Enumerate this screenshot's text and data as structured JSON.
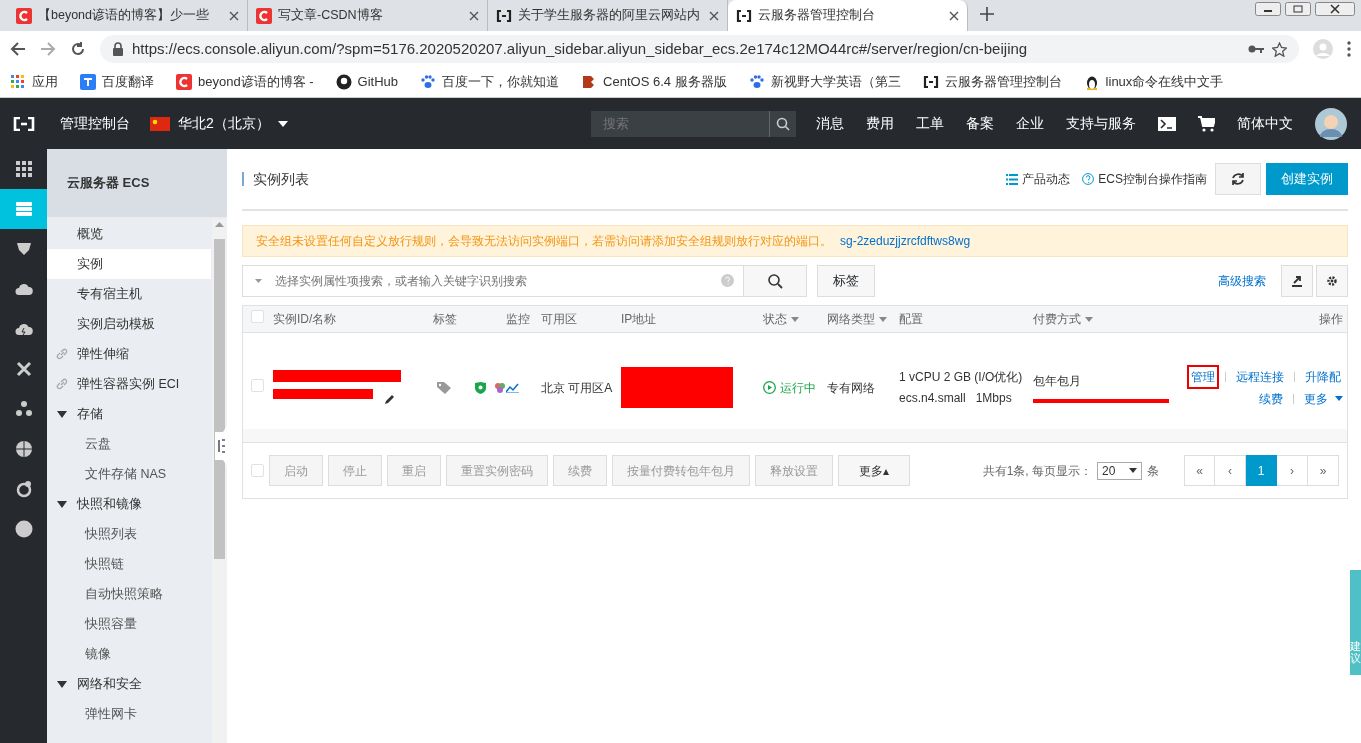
{
  "browser": {
    "tabs": [
      {
        "title": "【beyond谚语的博客】少一些",
        "selected": false
      },
      {
        "title": "写文章-CSDN博客",
        "selected": false
      },
      {
        "title": "关于学生服务器的阿里云网站内",
        "selected": false
      },
      {
        "title": "云服务器管理控制台",
        "selected": true
      }
    ],
    "url": "https://ecs.console.aliyun.com/?spm=5176.2020520207.aliyun_sidebar.aliyun_sidebar_ecs.2e174c12MO44rc#/server/region/cn-beijing",
    "bookmarks": [
      "应用",
      "百度翻译",
      "beyond谚语的博客 -",
      "GitHub",
      "百度一下，你就知道",
      "CentOS 6.4 服务器版",
      "新视野大学英语（第三",
      "云服务器管理控制台",
      "linux命令在线中文手"
    ]
  },
  "topbar": {
    "brand": "管理控制台",
    "region": "华北2（北京）",
    "search_placeholder": "搜索",
    "nav": [
      "消息",
      "费用",
      "工单",
      "备案",
      "企业",
      "支持与服务"
    ],
    "language": "简体中文"
  },
  "rail": [
    {
      "selected": false
    },
    {
      "selected": true
    },
    {
      "selected": false
    },
    {
      "selected": false
    },
    {
      "selected": false
    },
    {
      "selected": false
    },
    {
      "selected": false
    },
    {
      "selected": false
    },
    {
      "selected": false
    },
    {
      "selected": false
    }
  ],
  "sidebar": {
    "title": "云服务器 ECS",
    "items": [
      {
        "label": "概览",
        "kind": "item",
        "selected": false
      },
      {
        "label": "实例",
        "kind": "item",
        "selected": true
      },
      {
        "label": "专有宿主机",
        "kind": "item",
        "selected": false
      },
      {
        "label": "实例启动模板",
        "kind": "item",
        "selected": false
      },
      {
        "label": "弹性伸缩",
        "kind": "link",
        "selected": false
      },
      {
        "label": "弹性容器实例 ECI",
        "kind": "link",
        "selected": false
      },
      {
        "label": "存储",
        "kind": "group",
        "expanded": true,
        "children": [
          {
            "label": "云盘"
          },
          {
            "label": "文件存储 NAS"
          }
        ]
      },
      {
        "label": "快照和镜像",
        "kind": "group",
        "expanded": true,
        "children": [
          {
            "label": "快照列表"
          },
          {
            "label": "快照链"
          },
          {
            "label": "自动快照策略"
          },
          {
            "label": "快照容量"
          },
          {
            "label": "镜像"
          }
        ]
      },
      {
        "label": "网络和安全",
        "kind": "group",
        "expanded": true,
        "children": [
          {
            "label": "弹性网卡"
          }
        ]
      }
    ]
  },
  "main": {
    "title": "实例列表",
    "links": [
      "产品动态",
      "ECS控制台操作指南"
    ],
    "create_button": "创建实例",
    "alert": {
      "text": "安全组未设置任何自定义放行规则，会导致无法访问实例端口，若需访问请添加安全组规则放行对应的端口。",
      "link": "sg-2zeduzjjzrcfdftws8wg"
    },
    "search_placeholder": "选择实例属性项搜索，或者输入关键字识别搜索",
    "tag_button": "标签",
    "advanced_search": "高级搜索",
    "table": {
      "all_checked": false,
      "columns": [
        "实例ID/名称",
        "标签",
        "监控",
        "可用区",
        "IP地址",
        "状态",
        "网络类型",
        "配置",
        "付费方式",
        "操作"
      ],
      "rows": [
        {
          "checked": false,
          "zone": "北京 可用区A",
          "status": "运行中",
          "network": "专有网络",
          "config": [
            "1 vCPU 2 GB (I/O优化)",
            "ecs.n4.small   1Mbps"
          ],
          "billing": "包年包月",
          "actions": [
            {
              "label": "管理",
              "highlighted": true
            },
            {
              "label": "远程连接",
              "highlighted": false
            },
            {
              "label": "升降配",
              "highlighted": false
            },
            {
              "label": "续费",
              "highlighted": false
            },
            {
              "label": "更多",
              "highlighted": false
            }
          ]
        }
      ]
    },
    "footer_checked": false,
    "bulk_buttons": [
      "启动",
      "停止",
      "重启",
      "重置实例密码",
      "续费",
      "按量付费转包年包月",
      "释放设置"
    ],
    "more_button": "更多▴",
    "pagination": {
      "summary": "共有1条, 每页显示：",
      "page_size": "20",
      "unit": "条",
      "pages": [
        {
          "label": "«",
          "selected": false
        },
        {
          "label": "‹",
          "selected": false
        },
        {
          "label": "1",
          "selected": true
        },
        {
          "label": "›",
          "selected": false
        },
        {
          "label": "»",
          "selected": false
        }
      ]
    }
  },
  "feedback": "建议"
}
